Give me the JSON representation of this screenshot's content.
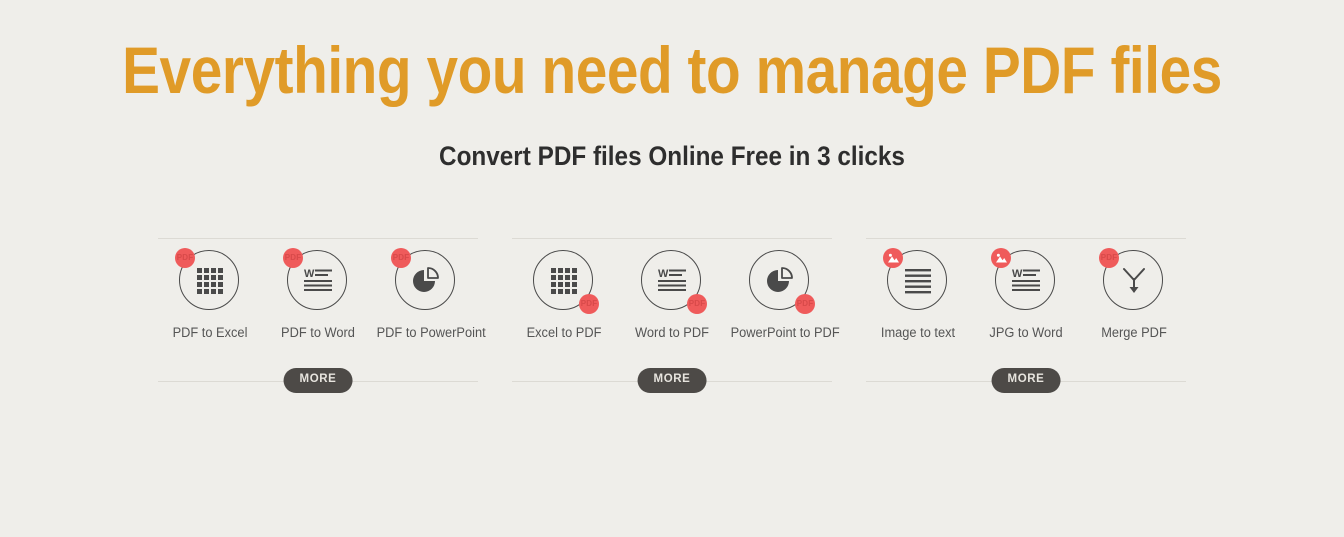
{
  "hero": {
    "title": "Everything you need to manage PDF files",
    "subtitle": "Convert PDF files Online Free in 3 clicks"
  },
  "colors": {
    "background": "#efeeea",
    "title_accent": "#e09b28",
    "badge_red": "#ef5b5b",
    "more_pill": "#4d4a47",
    "icon_stroke": "#4a4a4a",
    "label_text": "#555555",
    "rule": "#dcdad4"
  },
  "groups": [
    {
      "more_label": "MORE",
      "tiles": [
        {
          "label": "PDF to Excel",
          "icon": "grid-icon",
          "badge": {
            "kind": "pdf",
            "text": "PDF",
            "position": "top-left"
          }
        },
        {
          "label": "PDF to Word",
          "icon": "word-doc-icon",
          "badge": {
            "kind": "pdf",
            "text": "PDF",
            "position": "top-left"
          }
        },
        {
          "label": "PDF to PowerPoint",
          "icon": "pie-chart-icon",
          "badge": {
            "kind": "pdf",
            "text": "PDF",
            "position": "top-left"
          }
        }
      ]
    },
    {
      "more_label": "MORE",
      "tiles": [
        {
          "label": "Excel to PDF",
          "icon": "grid-icon",
          "badge": {
            "kind": "pdf",
            "text": "PDF",
            "position": "bottom-right"
          }
        },
        {
          "label": "Word to PDF",
          "icon": "word-doc-icon",
          "badge": {
            "kind": "pdf",
            "text": "PDF",
            "position": "bottom-right"
          }
        },
        {
          "label": "PowerPoint to PDF",
          "icon": "pie-chart-icon",
          "badge": {
            "kind": "pdf",
            "text": "PDF",
            "position": "bottom-right"
          }
        }
      ]
    },
    {
      "more_label": "MORE",
      "tiles": [
        {
          "label": "Image to text",
          "icon": "text-lines-icon",
          "badge": {
            "kind": "image",
            "text": "",
            "position": "top-left"
          }
        },
        {
          "label": "JPG to Word",
          "icon": "word-doc-icon",
          "badge": {
            "kind": "image",
            "text": "",
            "position": "top-left"
          }
        },
        {
          "label": "Merge PDF",
          "icon": "merge-arrow-icon",
          "badge": {
            "kind": "pdf",
            "text": "PDF",
            "position": "top-left"
          }
        }
      ]
    }
  ]
}
